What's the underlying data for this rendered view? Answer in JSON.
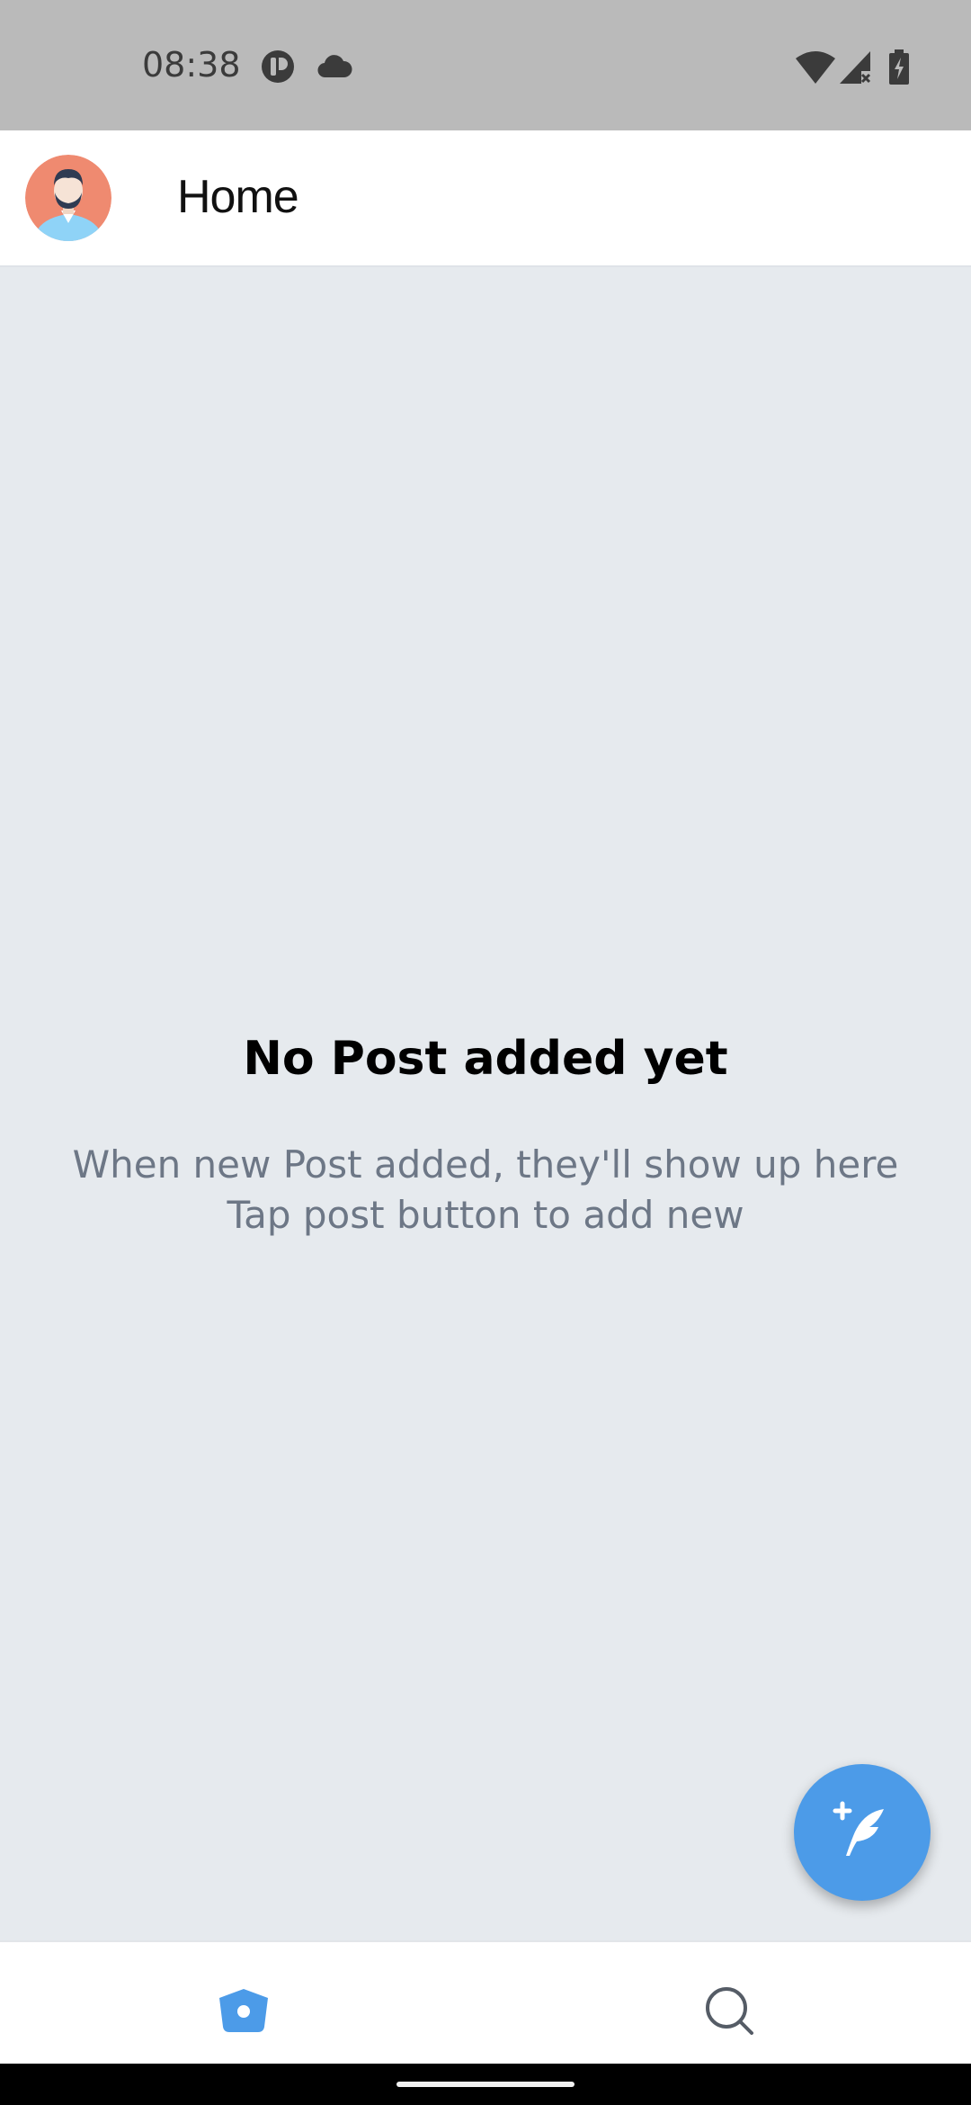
{
  "status_bar": {
    "time": "08:38",
    "icons": [
      "app-notification-icon",
      "cloud-icon",
      "wifi-icon",
      "signal-no-service-icon",
      "battery-charging-icon"
    ]
  },
  "app_bar": {
    "title": "Home",
    "avatar_icon": "user-avatar"
  },
  "empty_state": {
    "title": "No Post added yet",
    "subtitle_line1": "When new Post added, they'll show up here",
    "subtitle_line2": "Tap post button to add new"
  },
  "fab": {
    "icon": "add-post-feather-icon"
  },
  "bottom_nav": {
    "items": [
      {
        "icon": "home-icon",
        "active": true
      },
      {
        "icon": "search-icon",
        "active": false
      }
    ]
  },
  "colors": {
    "accent": "#4c9be8",
    "background": "#e6eaee",
    "status_bar": "#bababa",
    "subtitle_text": "#6d7786"
  }
}
